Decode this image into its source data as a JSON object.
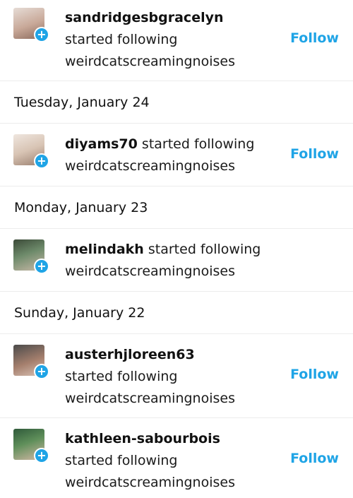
{
  "activity": [
    {
      "username": "sandridgesbgracelyn",
      "action": "started following",
      "target": "weirdcatscreamingnoises",
      "follow_label": "Follow",
      "avatar_colors": [
        "#c8a898",
        "#8b6a5c",
        "#e6dcd6"
      ]
    },
    {
      "date": "Tuesday, January 24"
    },
    {
      "username": "diyams70",
      "action": "started following",
      "target": "weirdcatscreamingnoises",
      "follow_label": "Follow",
      "avatar_colors": [
        "#d8c4b4",
        "#9a7f6f",
        "#efe6df"
      ]
    },
    {
      "date": "Monday, January 23"
    },
    {
      "username": "melindakh",
      "action": "started following",
      "target": "weirdcatscreamingnoises",
      "avatar_colors": [
        "#6d8a6a",
        "#c9b9a8",
        "#3b4a38"
      ]
    },
    {
      "date": "Sunday, January 22"
    },
    {
      "username": "austerhjloreen63",
      "action": "started following",
      "target": "weirdcatscreamingnoises",
      "follow_label": "Follow",
      "avatar_colors": [
        "#4a4a4a",
        "#d9c2b5",
        "#a57f6d"
      ]
    },
    {
      "username": "kathleen-sabourbois",
      "action": "started following",
      "target": "weirdcatscreamingnoises",
      "follow_label": "Follow",
      "avatar_colors": [
        "#5f8f5a",
        "#d4b8a6",
        "#2f5a3a"
      ]
    }
  ],
  "colors": {
    "accent": "#1fa4e6",
    "divider": "#ececec",
    "text": "#1a1a1a"
  }
}
